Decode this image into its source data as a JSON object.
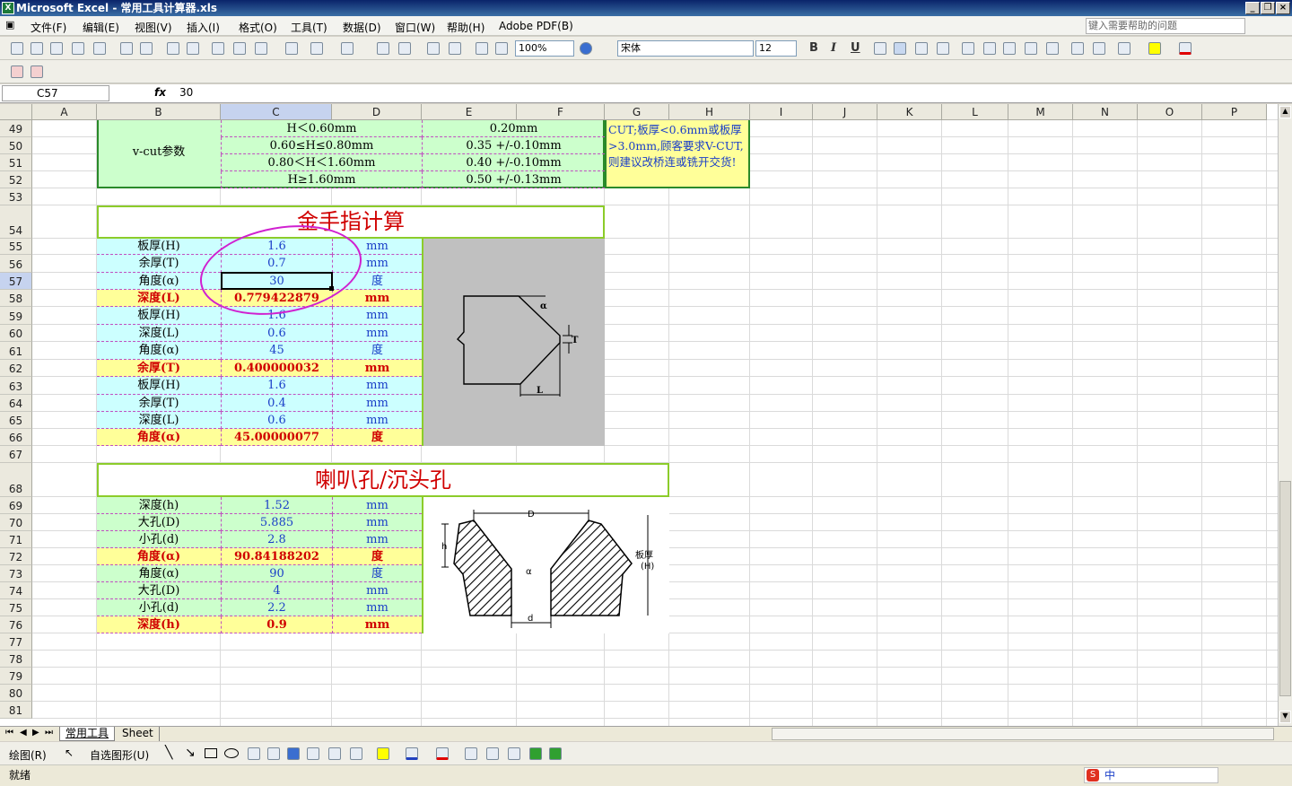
{
  "window": {
    "title": "Microsoft Excel - 常用工具计算器.xls",
    "app_icon": "excel-icon"
  },
  "menu": {
    "items": [
      "文件(F)",
      "编辑(E)",
      "视图(V)",
      "插入(I)",
      "格式(O)",
      "工具(T)",
      "数据(D)",
      "窗口(W)",
      "帮助(H)",
      "Adobe PDF(B)"
    ],
    "help_placeholder": "键入需要帮助的问题"
  },
  "toolbar": {
    "zoom": "100%",
    "font": "宋体",
    "font_size": "12",
    "bold": "B",
    "italic": "I",
    "underline": "U"
  },
  "formula": {
    "name_box": "C57",
    "fx": "fx",
    "value": "30"
  },
  "columns": [
    "A",
    "B",
    "C",
    "D",
    "E",
    "F",
    "G",
    "H",
    "I",
    "J",
    "K",
    "L",
    "M",
    "N",
    "O",
    "P"
  ],
  "rows": [
    "49",
    "50",
    "51",
    "52",
    "53",
    "54",
    "55",
    "56",
    "57",
    "58",
    "59",
    "60",
    "61",
    "62",
    "63",
    "64",
    "65",
    "66",
    "67",
    "68",
    "69",
    "70",
    "71",
    "72",
    "73",
    "74",
    "75",
    "76",
    "77",
    "78",
    "79",
    "80",
    "81"
  ],
  "vcut": {
    "label": "v-cut参数",
    "ranges": [
      "H＜0.60mm",
      "0.60≤H≤0.80mm",
      "0.80＜H＜1.60mm",
      "H≥1.60mm"
    ],
    "values": [
      "0.20mm",
      "0.35 +/-0.10mm",
      "0.40 +/-0.10mm",
      "0.50 +/-0.13mm"
    ],
    "note": "CUT;板厚<0.6mm或板厚>3.0mm,顾客要求V-CUT,则建议改桥连或铣开交货!"
  },
  "gold": {
    "title": "金手指计算",
    "rows": [
      {
        "label": "板厚(H)",
        "value": "1.6",
        "unit": "mm",
        "kind": "in"
      },
      {
        "label": "余厚(T)",
        "value": "0.7",
        "unit": "mm",
        "kind": "in"
      },
      {
        "label": "角度(α)",
        "value": "30",
        "unit": "度",
        "kind": "in"
      },
      {
        "label": "深度(L)",
        "value": "0.779422879",
        "unit": "mm",
        "kind": "out"
      },
      {
        "label": "板厚(H)",
        "value": "1.6",
        "unit": "mm",
        "kind": "in"
      },
      {
        "label": "深度(L)",
        "value": "0.6",
        "unit": "mm",
        "kind": "in"
      },
      {
        "label": "角度(α)",
        "value": "45",
        "unit": "度",
        "kind": "in"
      },
      {
        "label": "余厚(T)",
        "value": "0.400000032",
        "unit": "mm",
        "kind": "out"
      },
      {
        "label": "板厚(H)",
        "value": "1.6",
        "unit": "mm",
        "kind": "in"
      },
      {
        "label": "余厚(T)",
        "value": "0.4",
        "unit": "mm",
        "kind": "in"
      },
      {
        "label": "深度(L)",
        "value": "0.6",
        "unit": "mm",
        "kind": "in"
      },
      {
        "label": "角度(α)",
        "value": "45.00000077",
        "unit": "度",
        "kind": "out"
      }
    ],
    "diagram": {
      "alpha": "α",
      "t": "T",
      "l": "L"
    }
  },
  "horn": {
    "title": "喇叭孔/沉头孔",
    "rows": [
      {
        "label": "深度(h)",
        "value": "1.52",
        "unit": "mm",
        "kind": "in"
      },
      {
        "label": "大孔(D)",
        "value": "5.885",
        "unit": "mm",
        "kind": "in"
      },
      {
        "label": "小孔(d)",
        "value": "2.8",
        "unit": "mm",
        "kind": "in"
      },
      {
        "label": "角度(α)",
        "value": "90.84188202",
        "unit": "度",
        "kind": "out"
      },
      {
        "label": "角度(α)",
        "value": "90",
        "unit": "度",
        "kind": "in"
      },
      {
        "label": "大孔(D)",
        "value": "4",
        "unit": "mm",
        "kind": "in"
      },
      {
        "label": "小孔(d)",
        "value": "2.2",
        "unit": "mm",
        "kind": "in"
      },
      {
        "label": "深度(h)",
        "value": "0.9",
        "unit": "mm",
        "kind": "out"
      }
    ],
    "diagram": {
      "D": "D",
      "d": "d",
      "h": "h",
      "alpha": "α",
      "thick1": "板厚",
      "thick2": "(H)"
    }
  },
  "sheets": {
    "active": "常用工具",
    "other": "Sheet"
  },
  "drawbar": {
    "draw": "绘图(R)",
    "autoshape": "自选图形(U)"
  },
  "status": {
    "ready": "就绪",
    "ime": "中"
  }
}
